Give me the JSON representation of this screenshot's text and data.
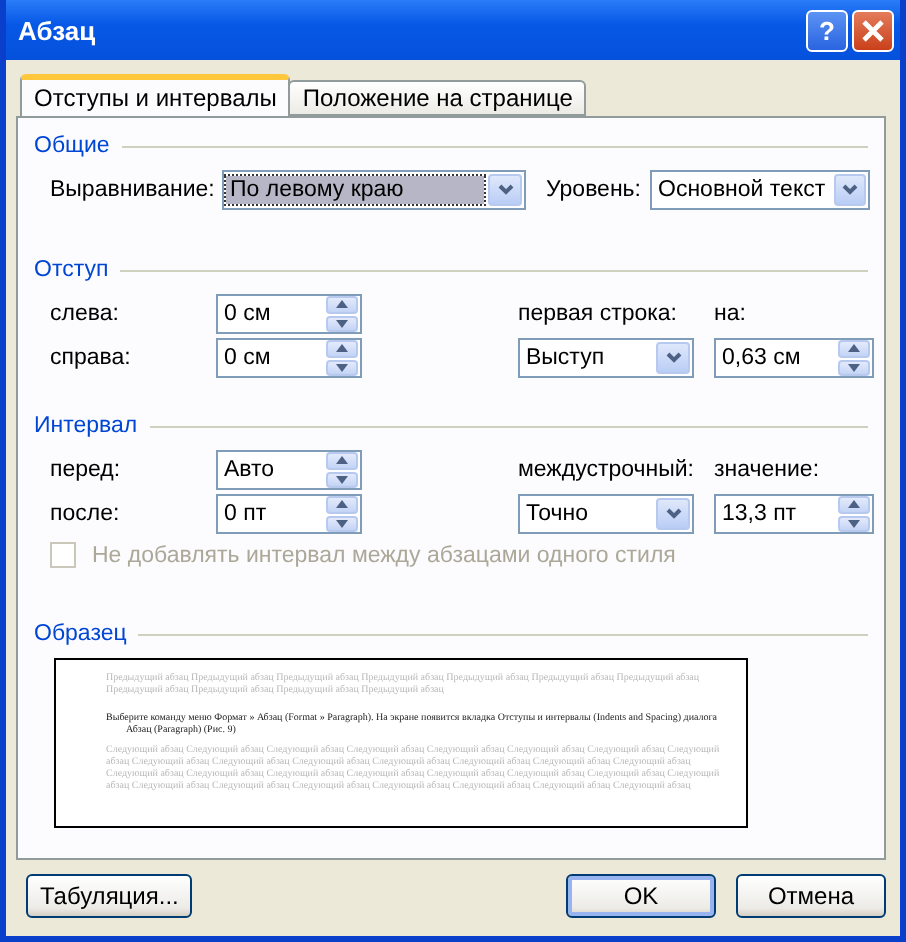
{
  "window": {
    "title": "Абзац",
    "help_label": "?"
  },
  "tabs": [
    {
      "label": "Отступы и интервалы",
      "selected": true
    },
    {
      "label": "Положение на странице",
      "selected": false
    }
  ],
  "general": {
    "title": "Общие",
    "alignment": {
      "label": "Выравнивание:",
      "value": "По левому краю",
      "focused": true
    },
    "level": {
      "label": "Уровень:",
      "value": "Основной текст",
      "focused": false
    }
  },
  "indent": {
    "title": "Отступ",
    "left": {
      "label": "слева:",
      "value": "0 см"
    },
    "right": {
      "label": "справа:",
      "value": "0 см"
    },
    "first_line": {
      "label": "первая строка:",
      "value": "Выступ",
      "focused": false
    },
    "by": {
      "label": "на:",
      "value": "0,63 см"
    }
  },
  "spacing": {
    "title": "Интервал",
    "before": {
      "label": "перед:",
      "value": "Авто"
    },
    "after": {
      "label": "после:",
      "value": "0 пт"
    },
    "line_spacing": {
      "label": "междустрочный:",
      "value": "Точно",
      "focused": false
    },
    "at": {
      "label": "значение:",
      "value": "13,3 пт"
    },
    "no_space_same_style": {
      "label": "Не добавлять интервал между абзацами одного стиля",
      "checked": false,
      "disabled": true
    }
  },
  "preview": {
    "title": "Образец",
    "previous_text": "Предыдущий абзац Предыдущий абзац Предыдущий абзац Предыдущий абзац Предыдущий абзац Предыдущий абзац Предыдущий абзац Предыдущий абзац Предыдущий абзац Предыдущий абзац Предыдущий абзац",
    "current_text": "Выберите команду меню Формат » Абзац (Format » Paragraph). На экране появится вкладка Отступы и интервалы (Indents and Spacing) диалога Абзац (Paragraph) (Рис. 9)",
    "next_text": "Следующий абзац Следующий абзац Следующий абзац Следующий абзац Следующий абзац Следующий абзац Следующий абзац Следующий абзац Следующий абзац Следующий абзац Следующий абзац Следующий абзац Следующий абзац Следующий абзац Следующий абзац Следующий абзац Следующий абзац Следующий абзац Следующий абзац Следующий абзац Следующий абзац Следующий абзац Следующий абзац Следующий абзац Следующий абзац Следующий абзац Следующий абзац Следующий абзац Следующий абзац Следующий абзац"
  },
  "buttons": [
    {
      "label": "Табуляция...",
      "default": false
    },
    {
      "label": "OK",
      "default": true
    },
    {
      "label": "Отмена",
      "default": false
    }
  ]
}
